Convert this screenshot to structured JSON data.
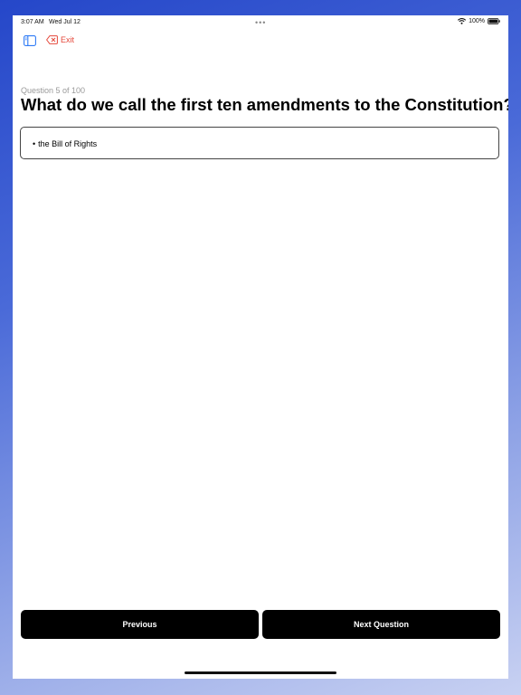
{
  "status_bar": {
    "time": "3:07 AM",
    "date": "Wed Jul 12",
    "battery": "100%"
  },
  "toolbar": {
    "sidebar_icon": "sidebar-icon",
    "exit_icon": "delete-left-icon",
    "exit_label": "Exit",
    "accent_color": "#e5483b",
    "sidebar_color": "#2f7bf5"
  },
  "question": {
    "counter": "Question 5 of 100",
    "title": "What do we call the first ten amendments to the Constitution?"
  },
  "answers": [
    {
      "bullet": "•",
      "text": "the Bill of Rights"
    }
  ],
  "buttons": {
    "previous": "Previous",
    "next": "Next Question"
  }
}
